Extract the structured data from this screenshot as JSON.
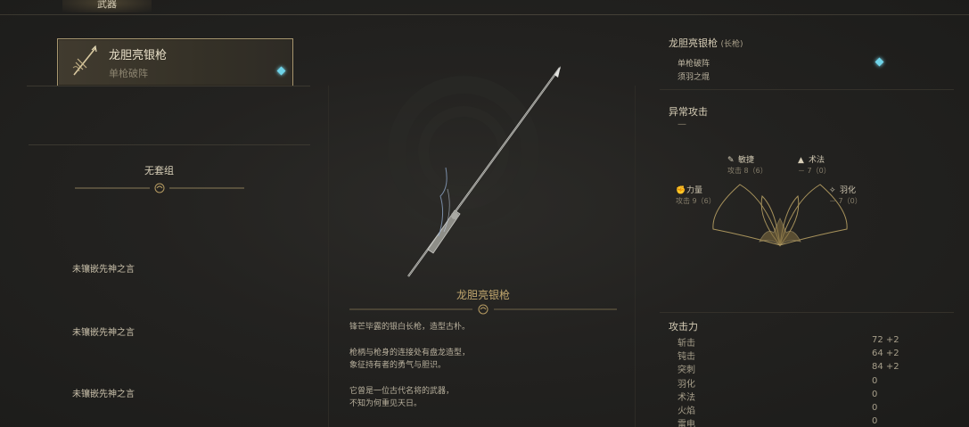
{
  "top_tab": {
    "label": "武器"
  },
  "weapon_card": {
    "name": "龙胆亮银枪",
    "skill": "单枪破阵",
    "icon": "spear-icon",
    "gem_color": "#6fd3e8"
  },
  "set": {
    "title": "无套组"
  },
  "slots": [
    {
      "label": "未镶嵌先神之言"
    },
    {
      "label": "未镶嵌先神之言"
    },
    {
      "label": "未镶嵌先神之言"
    }
  ],
  "center": {
    "weapon_name": "龙胆亮银枪",
    "desc1": "锋芒毕露的银白长枪，造型古朴。",
    "desc2a": "枪柄与枪身的连接处有盘龙造型，",
    "desc2b": "象征持有者的勇气与胆识。",
    "desc3a": "它曾是一位古代名将的武器，",
    "desc3b": "不知为何重见天日。"
  },
  "right": {
    "title": "龙胆亮银枪",
    "title_sub": "(长枪)",
    "skills": [
      "单枪破阵",
      "须羽之焜"
    ],
    "abnormal_title": "异常攻击",
    "abnormal_value": "—",
    "attributes": {
      "agility": {
        "label": "敏捷",
        "value": "攻击 8（6）",
        "icon": "feather-icon"
      },
      "sorcery": {
        "label": "术法",
        "value": "－ 7（0）",
        "icon": "flame-icon"
      },
      "strength": {
        "label": "力量",
        "value": "攻击 9（6）",
        "icon": "fist-icon"
      },
      "feather": {
        "label": "羽化",
        "value": "－ 7（0）",
        "icon": "wing-icon"
      }
    },
    "attack_title": "攻击力",
    "attack_stats": [
      {
        "name": "斩击",
        "value": "72 +2"
      },
      {
        "name": "钝击",
        "value": "64 +2"
      },
      {
        "name": "突刺",
        "value": "84 +2"
      },
      {
        "name": "羽化",
        "value": "0"
      },
      {
        "name": "术法",
        "value": "0"
      },
      {
        "name": "火焰",
        "value": "0"
      },
      {
        "name": "雷电",
        "value": "0"
      }
    ]
  }
}
